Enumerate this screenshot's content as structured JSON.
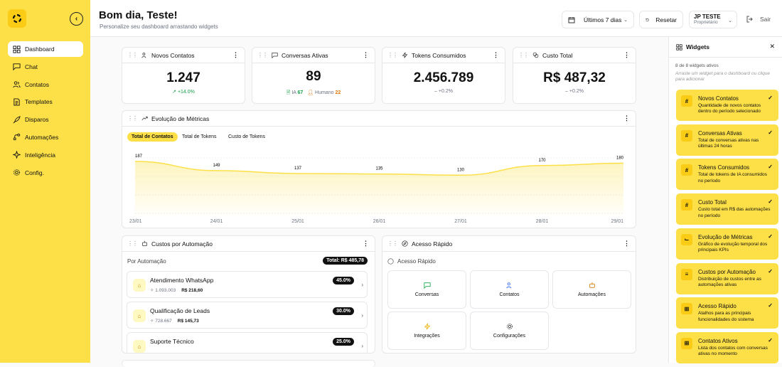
{
  "sidebar": {
    "items": [
      {
        "label": "Dashboard",
        "icon": "grid-icon"
      },
      {
        "label": "Chat",
        "icon": "chat-icon"
      },
      {
        "label": "Contatos",
        "icon": "users-icon"
      },
      {
        "label": "Templates",
        "icon": "document-icon"
      },
      {
        "label": "Disparos",
        "icon": "rocket-icon"
      },
      {
        "label": "Automações",
        "icon": "workflow-icon"
      },
      {
        "label": "Inteligência",
        "icon": "sparkle-icon"
      },
      {
        "label": "Config.",
        "icon": "gear-icon"
      }
    ]
  },
  "header": {
    "title": "Bom dia, Teste!",
    "subtitle": "Personalize seu dashboard arrastando widgets",
    "period": "Últimos 7 dias",
    "reset": "Resetar",
    "user_name": "JP TESTE",
    "user_role": "Proprietário",
    "logout": "Sair"
  },
  "kpis": {
    "novos": {
      "title": "Novos Contatos",
      "value": "1.247",
      "delta": "+14.0%"
    },
    "conversas": {
      "title": "Conversas Ativas",
      "value": "89",
      "ia_label": "IA",
      "ia": "67",
      "humano_label": "Humano",
      "humano": "22"
    },
    "tokens": {
      "title": "Tokens Consumidos",
      "value": "2.456.789",
      "delta": "+0.2%"
    },
    "custo": {
      "title": "Custo Total",
      "value": "R$ 487,32",
      "delta": "+0.2%"
    }
  },
  "metrics": {
    "title": "Evolução de Métricas",
    "tabs": [
      "Total de Contatos",
      "Total de Tokens",
      "Custo de Tokens"
    ],
    "active_tab": "Total de Contatos"
  },
  "chart_data": {
    "type": "area",
    "categories": [
      "23/01",
      "24/01",
      "25/01",
      "26/01",
      "27/01",
      "28/01",
      "29/01"
    ],
    "series": [
      {
        "values": [
          187,
          149,
          137,
          135,
          130,
          170,
          180
        ]
      }
    ],
    "color": "#fde047"
  },
  "costs": {
    "title": "Custos por Automação",
    "subtitle": "Por Automação",
    "total": "Total: R$ 485,78",
    "items": [
      {
        "name": "Atendimento WhatsApp",
        "tokens": "1.093.003",
        "cost": "R$ 218,60",
        "pct": "45.0%"
      },
      {
        "name": "Qualificação de Leads",
        "tokens": "728.667",
        "cost": "R$ 145,73",
        "pct": "30.0%"
      },
      {
        "name": "Suporte Técnico",
        "tokens": "",
        "cost": "",
        "pct": "25.0%"
      }
    ]
  },
  "quick": {
    "title": "Acesso Rápido",
    "subtitle": "Acesso Rápido",
    "items": [
      "Conversas",
      "Contatos",
      "Automações",
      "Integrações",
      "Configurações"
    ]
  },
  "widgets": {
    "title": "Widgets",
    "count": "8 de 8 widgets ativos",
    "hint": "Arraste um widget para o dashboard ou clique para adicionar",
    "items": [
      {
        "name": "Novos Contatos",
        "desc": "Quantidade de novos contatos dentro do período selecionado",
        "icon": "#"
      },
      {
        "name": "Conversas Ativas",
        "desc": "Total de conversas ativas nas últimas 24 horas",
        "icon": "#"
      },
      {
        "name": "Tokens Consumidos",
        "desc": "Total de tokens de IA consumidos no período",
        "icon": "#"
      },
      {
        "name": "Custo Total",
        "desc": "Custo total em R$ das automações no período",
        "icon": "#"
      },
      {
        "name": "Evolução de Métricas",
        "desc": "Gráfico de evolução temporal dos principais KPIs",
        "icon": "chart"
      },
      {
        "name": "Custos por Automação",
        "desc": "Distribuição de custos entre as automações ativas",
        "icon": "list"
      },
      {
        "name": "Acesso Rápido",
        "desc": "Atalhos para as principais funcionalidades do sistema",
        "icon": "grid"
      },
      {
        "name": "Contatos Ativos",
        "desc": "Lista dos contatos com conversas ativas no momento",
        "icon": "grid"
      }
    ]
  }
}
